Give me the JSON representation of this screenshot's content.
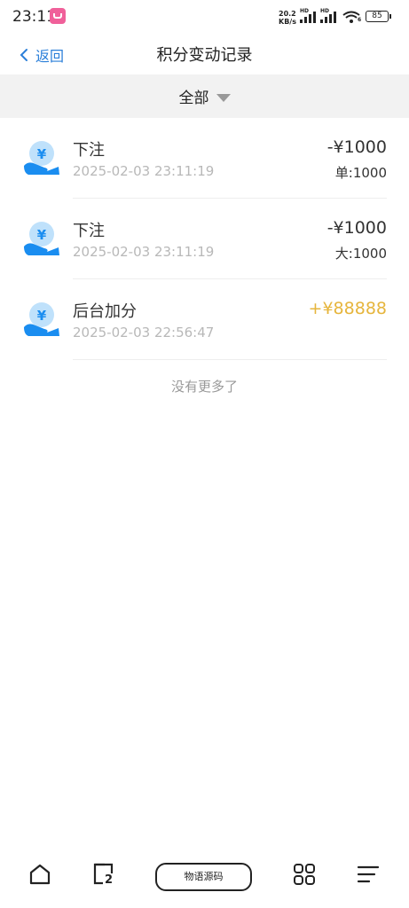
{
  "status": {
    "time": "23:11",
    "net_speed_value": "20.2",
    "net_speed_unit": "KB/s",
    "hd1": "HD",
    "hd2": "HD",
    "wifi_label": "6",
    "battery": "85"
  },
  "nav": {
    "back_label": "返回",
    "title": "积分变动记录"
  },
  "filter": {
    "label": "全部"
  },
  "records": [
    {
      "name": "下注",
      "time": "2025-02-03 23:11:19",
      "amount": "-¥1000",
      "sub": "单:1000"
    },
    {
      "name": "下注",
      "time": "2025-02-03 23:11:19",
      "amount": "-¥1000",
      "sub": "大:1000"
    },
    {
      "name": "后台加分",
      "time": "2025-02-03 22:56:47",
      "amount": "+¥88888",
      "sub": ""
    }
  ],
  "footer_text": "没有更多了",
  "bottom_bar": {
    "pill_label": "物语源码",
    "tabs_count": "2"
  },
  "colors": {
    "accent": "#2b7fd9",
    "plus": "#e6b53c",
    "icon_light": "#bfe1fb",
    "icon_dark": "#1a8df0"
  }
}
